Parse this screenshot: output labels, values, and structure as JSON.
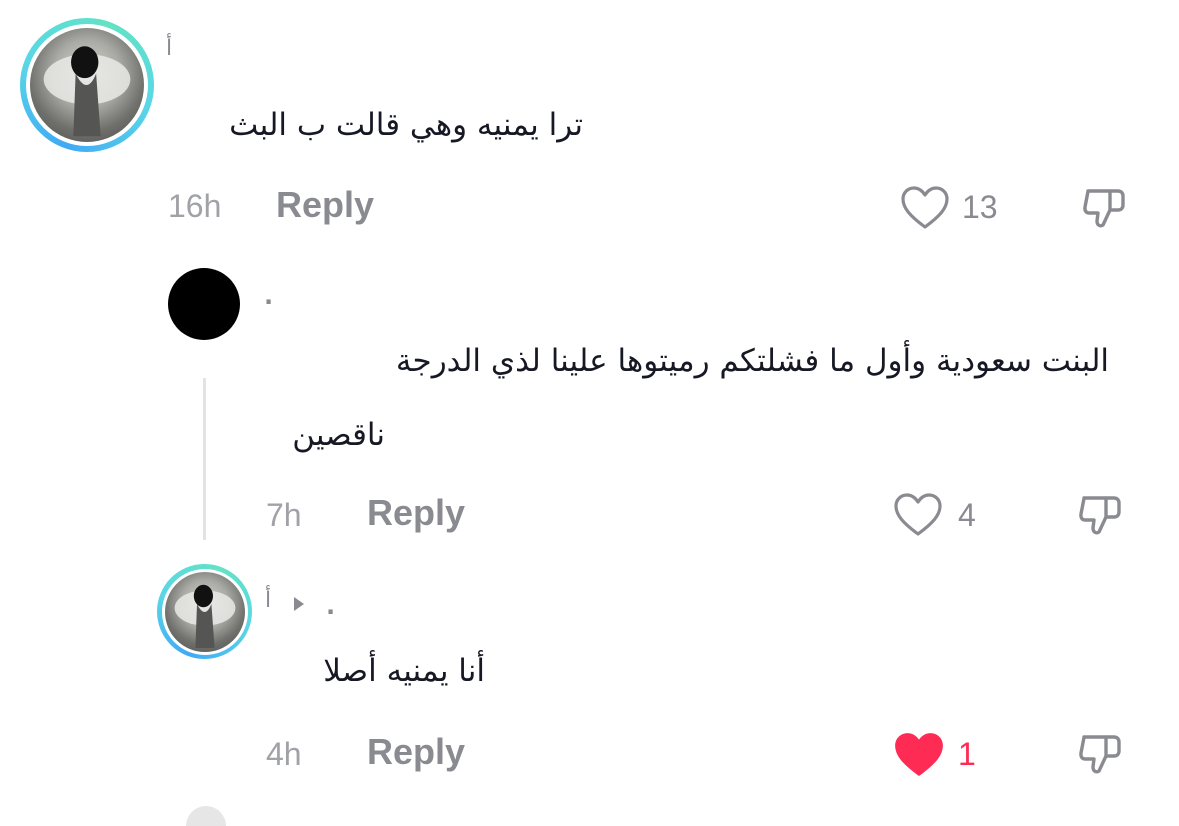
{
  "comments": [
    {
      "username": "أ",
      "text": "ترا يمنيه وهي قالت ب البث",
      "time": "16h",
      "reply_label": "Reply",
      "like_count": "13",
      "liked": false
    },
    {
      "username": ".",
      "text_line1": "البنت سعودية وأول ما فشلتكم رميتوها علينا لذي الدرجة",
      "text_line2": "ناقصين",
      "time": "7h",
      "reply_label": "Reply",
      "like_count": "4",
      "liked": false
    },
    {
      "username": "أ",
      "reply_to": ".",
      "text": "أنا يمنيه أصلا",
      "time": "4h",
      "reply_label": "Reply",
      "like_count": "1",
      "liked": true
    }
  ],
  "colors": {
    "like_active": "#fe2c55",
    "muted": "#8a8b91",
    "ring_start": "#3fa9f5",
    "ring_end": "#62e3c4"
  },
  "icons": [
    "heart-outline-icon",
    "heart-filled-icon",
    "dislike-icon",
    "reply-arrow-icon"
  ]
}
